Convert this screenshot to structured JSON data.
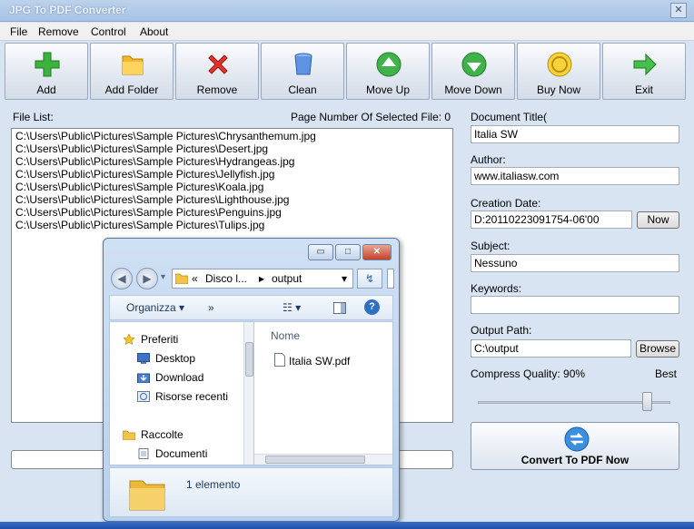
{
  "window": {
    "title": "JPG To PDF Converter",
    "close_glyph": "✕"
  },
  "menu": [
    "File",
    "Remove",
    "Control",
    "About"
  ],
  "toolbar": [
    {
      "label": "Add",
      "icon": "add-icon"
    },
    {
      "label": "Add Folder",
      "icon": "folder-icon"
    },
    {
      "label": "Remove",
      "icon": "remove-icon"
    },
    {
      "label": "Clean",
      "icon": "clean-icon"
    },
    {
      "label": "Move Up",
      "icon": "move-up-icon"
    },
    {
      "label": "Move Down",
      "icon": "move-down-icon"
    },
    {
      "label": "Buy Now",
      "icon": "buy-icon"
    },
    {
      "label": "Exit",
      "icon": "exit-icon"
    }
  ],
  "filelist": {
    "label": "File List:",
    "page_number_label": "Page Number Of Selected File: 0",
    "files": [
      "C:\\Users\\Public\\Pictures\\Sample Pictures\\Chrysanthemum.jpg",
      "C:\\Users\\Public\\Pictures\\Sample Pictures\\Desert.jpg",
      "C:\\Users\\Public\\Pictures\\Sample Pictures\\Hydrangeas.jpg",
      "C:\\Users\\Public\\Pictures\\Sample Pictures\\Jellyfish.jpg",
      "C:\\Users\\Public\\Pictures\\Sample Pictures\\Koala.jpg",
      "C:\\Users\\Public\\Pictures\\Sample Pictures\\Lighthouse.jpg",
      "C:\\Users\\Public\\Pictures\\Sample Pictures\\Penguins.jpg",
      "C:\\Users\\Public\\Pictures\\Sample Pictures\\Tulips.jpg"
    ]
  },
  "form": {
    "title_label": "Document Title(",
    "title_value": "Italia SW",
    "author_label": "Author:",
    "author_value": "www.italiasw.com",
    "creation_label": "Creation Date:",
    "creation_value": "D:20110223091754-06'00",
    "now_button": "Now",
    "subject_label": "Subject:",
    "subject_value": "Nessuno",
    "keywords_label": "Keywords:",
    "keywords_value": "",
    "output_label": "Output Path:",
    "output_value": "C:\\output",
    "browse_button": "Browse",
    "quality_label": "Compress Quality: 90%",
    "quality_best": "Best",
    "quality_value": 90,
    "convert_button": "Convert To PDF Now"
  },
  "explorer": {
    "caption_min": "▭",
    "caption_max": "□",
    "caption_close": "✕",
    "back_glyph": "◀",
    "forward_glyph": "▶",
    "nav_dropdown_glyph": "▾",
    "refresh_glyph": "↯",
    "address_prefix": "«",
    "address_part1": "Disco l...",
    "address_sep": "▸",
    "address_part2": "output",
    "address_dropdown": "▾",
    "organize": "Organizza ▾",
    "more": "»",
    "view_glyph": "☷ ▾",
    "help_glyph": "?",
    "nav": {
      "favorites": "Preferiti",
      "desktop": "Desktop",
      "download": "Download",
      "recent": "Risorse recenti",
      "libraries": "Raccolte",
      "documents": "Documenti"
    },
    "column_name": "Nome",
    "file_name": "Italia SW.pdf",
    "item_count": "1 elemento"
  }
}
